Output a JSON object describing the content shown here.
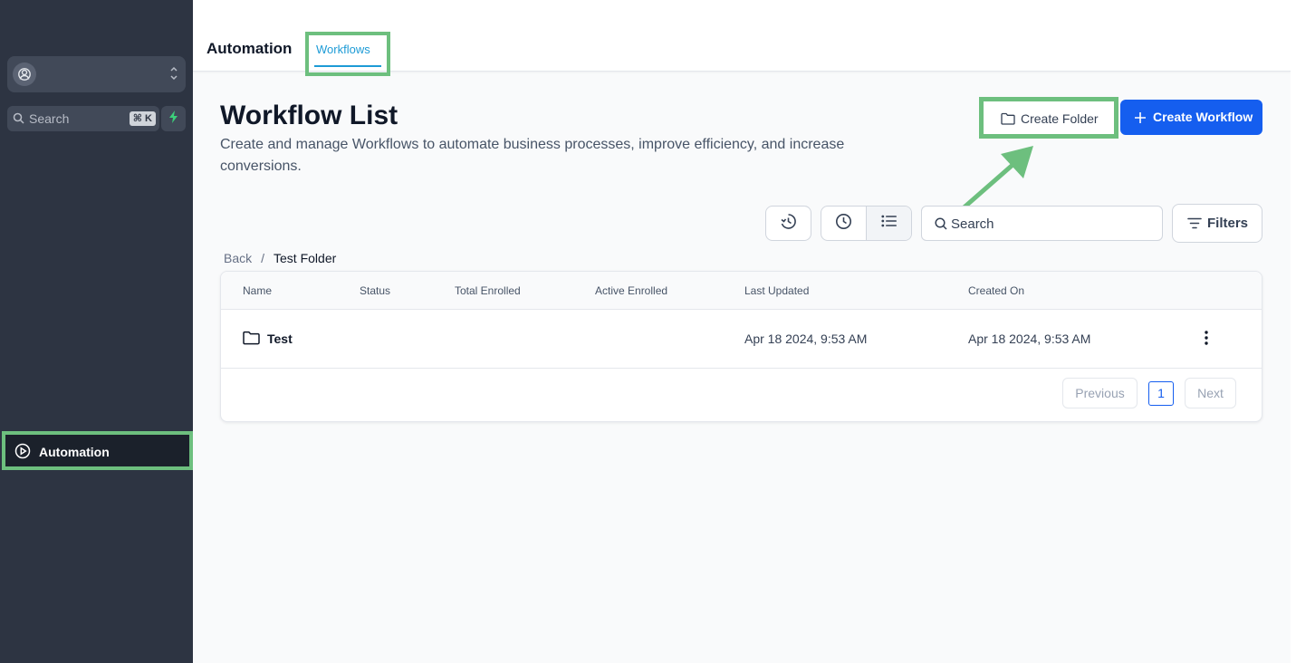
{
  "sidebar": {
    "account_icon": "user-circle-icon",
    "search_label": "Search",
    "search_shortcut": "⌘ K",
    "quick_action_icon": "bolt-icon",
    "nav_active": {
      "label": "Automation",
      "icon": "play-circle-icon"
    }
  },
  "header": {
    "app_title": "Automation",
    "tabs": [
      {
        "label": "Workflows",
        "active": true
      }
    ]
  },
  "page": {
    "title": "Workflow List",
    "description": "Create and manage Workflows to automate business processes, improve efficiency, and increase conversions.",
    "create_folder_label": "Create Folder",
    "create_workflow_label": "Create Workflow"
  },
  "toolbar": {
    "search_placeholder": "Search",
    "filters_label": "Filters"
  },
  "breadcrumb": {
    "back": "Back",
    "separator": "/",
    "current": "Test Folder"
  },
  "table": {
    "columns": [
      "Name",
      "Status",
      "Total Enrolled",
      "Active Enrolled",
      "Last Updated",
      "Created On"
    ],
    "rows": [
      {
        "name": "Test",
        "status": "",
        "total_enrolled": "",
        "active_enrolled": "",
        "last_updated": "Apr 18 2024, 9:53 AM",
        "created_on": "Apr 18 2024, 9:53 AM"
      }
    ]
  },
  "pagination": {
    "previous": "Previous",
    "current": "1",
    "next": "Next"
  },
  "colors": {
    "primary": "#155eef",
    "highlight": "#6dbf7e",
    "sidebar": "#2d3442",
    "tab_active": "#1d9bd6"
  }
}
